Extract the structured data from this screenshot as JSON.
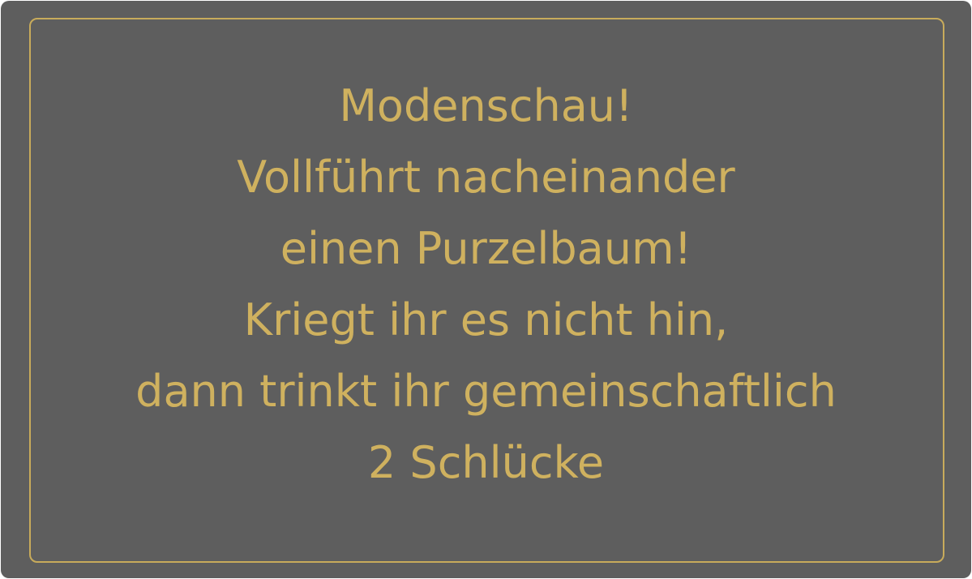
{
  "card": {
    "lines": [
      "Modenschau!",
      "Vollführt nacheinander",
      "einen Purzelbaum!",
      "Kriegt ihr es nicht hin,",
      "dann trinkt ihr gemeinschaftlich",
      "2 Schlücke"
    ],
    "colors": {
      "background": "#5e5e5e",
      "accent": "#c8ab5b"
    }
  }
}
